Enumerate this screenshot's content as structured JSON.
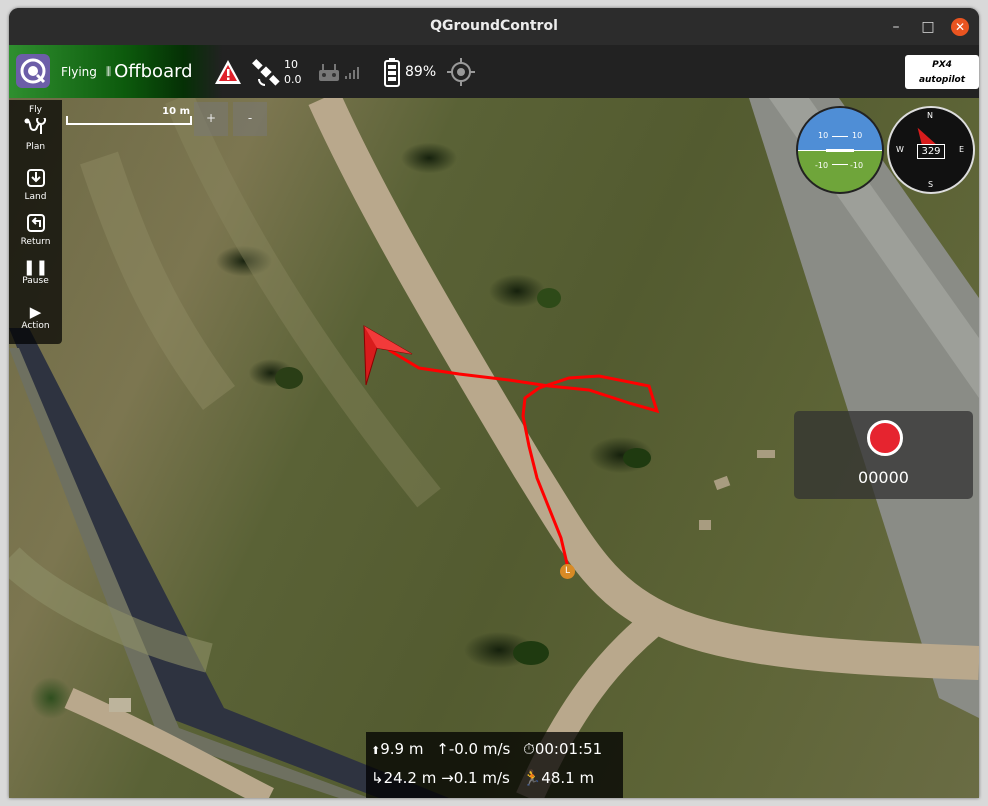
{
  "window": {
    "title": "QGroundControl",
    "minimize": "–",
    "maximize": "□",
    "close": "✕"
  },
  "toolbar": {
    "flight_state": "Flying",
    "flight_mode": "Offboard",
    "satellites": "10",
    "hdop": "0.0",
    "battery": "89%",
    "autopilot_logo": "PX4 autopilot"
  },
  "map": {
    "scale_label": "10 m",
    "zoom_in": "+",
    "zoom_out": "-",
    "home_label": "L",
    "accent_track": "#ff0000"
  },
  "toolstrip": {
    "items": [
      {
        "label": "Fly",
        "icon": "fly-icon"
      },
      {
        "label": "Plan",
        "icon": "plan-icon"
      },
      {
        "label": "Land",
        "icon": "land-icon"
      },
      {
        "label": "Return",
        "icon": "return-icon"
      },
      {
        "label": "Pause",
        "icon": "pause-icon"
      },
      {
        "label": "Action",
        "icon": "action-icon"
      }
    ]
  },
  "instruments": {
    "pitch_up": "10",
    "pitch_down": "-10",
    "heading": "329",
    "compass": {
      "n": "N",
      "e": "E",
      "s": "S",
      "w": "W"
    }
  },
  "video": {
    "record_time": "00000"
  },
  "telemetry": {
    "altitude": "9.9 m",
    "vertical_speed": "-0.0 m/s",
    "flight_time": "00:01:51",
    "distance_home": "24.2 m",
    "ground_speed": "0.1 m/s",
    "flight_distance": "48.1 m"
  }
}
